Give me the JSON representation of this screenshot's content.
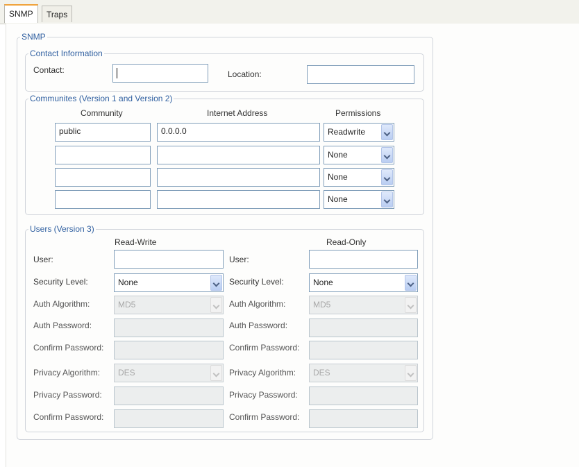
{
  "tabs": [
    {
      "label": "SNMP",
      "active": true
    },
    {
      "label": "Traps",
      "active": false
    }
  ],
  "snmp_group": {
    "legend": "SNMP"
  },
  "contact_info": {
    "legend": "Contact Information",
    "contact_label": "Contact:",
    "contact_value": "",
    "location_label": "Location:",
    "location_value": ""
  },
  "communities": {
    "legend": "Communites (Version 1 and Version 2)",
    "headers": {
      "community": "Community",
      "address": "Internet Address",
      "permissions": "Permissions"
    },
    "rows": [
      {
        "community": "public",
        "address": "0.0.0.0",
        "permission": "Readwrite"
      },
      {
        "community": "",
        "address": "",
        "permission": "None"
      },
      {
        "community": "",
        "address": "",
        "permission": "None"
      },
      {
        "community": "",
        "address": "",
        "permission": "None"
      }
    ]
  },
  "users": {
    "legend": "Users (Version 3)",
    "read_write": {
      "header": "Read-Write",
      "user_label": "User:",
      "user_value": "",
      "security_label": "Security Level:",
      "security_value": "None",
      "auth_algo_label": "Auth Algorithm:",
      "auth_algo_value": "MD5",
      "auth_pw_label": "Auth Password:",
      "confirm_pw_label": "Confirm Password:",
      "privacy_algo_label": "Privacy Algorithm:",
      "privacy_algo_value": "DES",
      "privacy_pw_label": "Privacy Password:",
      "confirm_pw2_label": "Confirm Password:"
    },
    "read_only": {
      "header": "Read-Only",
      "user_label": "User:",
      "user_value": "",
      "security_label": "Security Level:",
      "security_value": "None",
      "auth_algo_label": "Auth Algorithm:",
      "auth_algo_value": "MD5",
      "auth_pw_label": "Auth Password:",
      "confirm_pw_label": "Confirm Password:",
      "privacy_algo_label": "Privacy Algorithm:",
      "privacy_algo_value": "DES",
      "privacy_pw_label": "Privacy Password:",
      "confirm_pw2_label": "Confirm Password:"
    }
  },
  "icons": {
    "dropdown": "chevron-down-icon"
  },
  "colors": {
    "legend": "#2f5fa0",
    "tab_accent": "#f0a33b",
    "input_border": "#7f9db9"
  }
}
